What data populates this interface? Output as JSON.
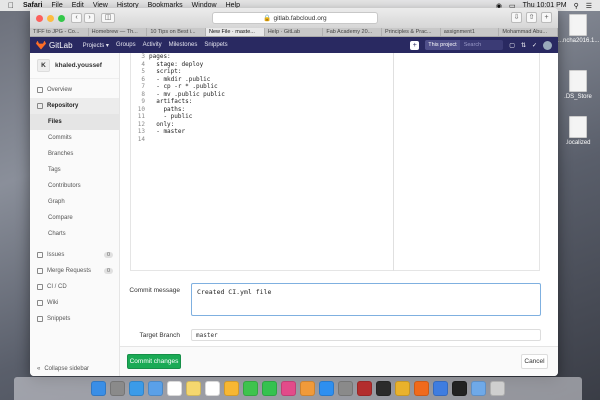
{
  "menubar": {
    "apple": "",
    "items": [
      "Safari",
      "File",
      "Edit",
      "View",
      "History",
      "Bookmarks",
      "Window",
      "Help"
    ],
    "clock": "Thu 10:01 PM"
  },
  "desktop": {
    "icons": [
      {
        "label": "...ncha2016.1..."
      },
      {
        "label": ".DS_Store"
      },
      {
        "label": ".localized"
      }
    ]
  },
  "browser": {
    "url": "gitlab.fabcloud.org",
    "tabs": [
      {
        "label": "TIFF to JPG - Co..."
      },
      {
        "label": "Homebrew — Th..."
      },
      {
        "label": "10 Tips on Best i..."
      },
      {
        "label": "New File · maste...",
        "active": true
      },
      {
        "label": "Help · GitLab"
      },
      {
        "label": "Fab Academy 20..."
      },
      {
        "label": "Principles & Prac..."
      },
      {
        "label": "assignment1"
      },
      {
        "label": "Mohammad Abu..."
      }
    ]
  },
  "gitlab_nav": {
    "brand": "GitLab",
    "links": [
      "Projects ▾",
      "Groups",
      "Activity",
      "Milestones",
      "Snippets"
    ],
    "search_scope": "This project",
    "search_placeholder": "Search"
  },
  "sidebar": {
    "project_initial": "K",
    "project_name": "khaled.youssef",
    "overview": "Overview",
    "repository": "Repository",
    "repo_items": [
      "Files",
      "Commits",
      "Branches",
      "Tags",
      "Contributors",
      "Graph",
      "Compare",
      "Charts"
    ],
    "issues": "Issues",
    "issues_count": "0",
    "merge_requests": "Merge Requests",
    "mr_count": "0",
    "cicd": "CI / CD",
    "wiki": "Wiki",
    "snippets": "Snippets",
    "collapse": "Collapse sidebar"
  },
  "editor": {
    "lines": [
      {
        "n": "3",
        "code": "pages:"
      },
      {
        "n": "4",
        "code": "  stage: deploy"
      },
      {
        "n": "5",
        "code": "  script:"
      },
      {
        "n": "6",
        "code": "  - mkdir .public"
      },
      {
        "n": "7",
        "code": "  - cp -r * .public"
      },
      {
        "n": "8",
        "code": "  - mv .public public"
      },
      {
        "n": "9",
        "code": "  artifacts:"
      },
      {
        "n": "10",
        "code": "    paths:"
      },
      {
        "n": "11",
        "code": "    - public"
      },
      {
        "n": "12",
        "code": "  only:"
      },
      {
        "n": "13",
        "code": "  - master"
      },
      {
        "n": "14",
        "code": ""
      }
    ]
  },
  "form": {
    "commit_label": "Commit message",
    "commit_value": "Created CI.yml file",
    "branch_label": "Target Branch",
    "branch_value": "master",
    "commit_button": "Commit changes",
    "cancel_button": "Cancel"
  },
  "dock": {
    "apps": [
      "finder",
      "launchpad",
      "safari",
      "mail",
      "calendar",
      "notes",
      "reminders",
      "photos",
      "messages",
      "facetime",
      "itunes",
      "ibooks",
      "appstore",
      "preferences",
      "filezilla",
      "terminal",
      "chrome",
      "firefox",
      "xcode",
      "terminal2",
      "folder",
      "trash"
    ],
    "colors": [
      "#3a8ee6",
      "#8a8a8a",
      "#3b9be8",
      "#5aa0e8",
      "#ffffff",
      "#f5d76e",
      "#ffffff",
      "#f7b733",
      "#3ec34d",
      "#35c24f",
      "#e24b8a",
      "#f09a3a",
      "#2e8ff0",
      "#8a8a8a",
      "#b32d2d",
      "#2b2b2b",
      "#e9b22c",
      "#f06a1c",
      "#3f7de0",
      "#222222",
      "#6fa9e8",
      "#cfcfcf"
    ]
  }
}
